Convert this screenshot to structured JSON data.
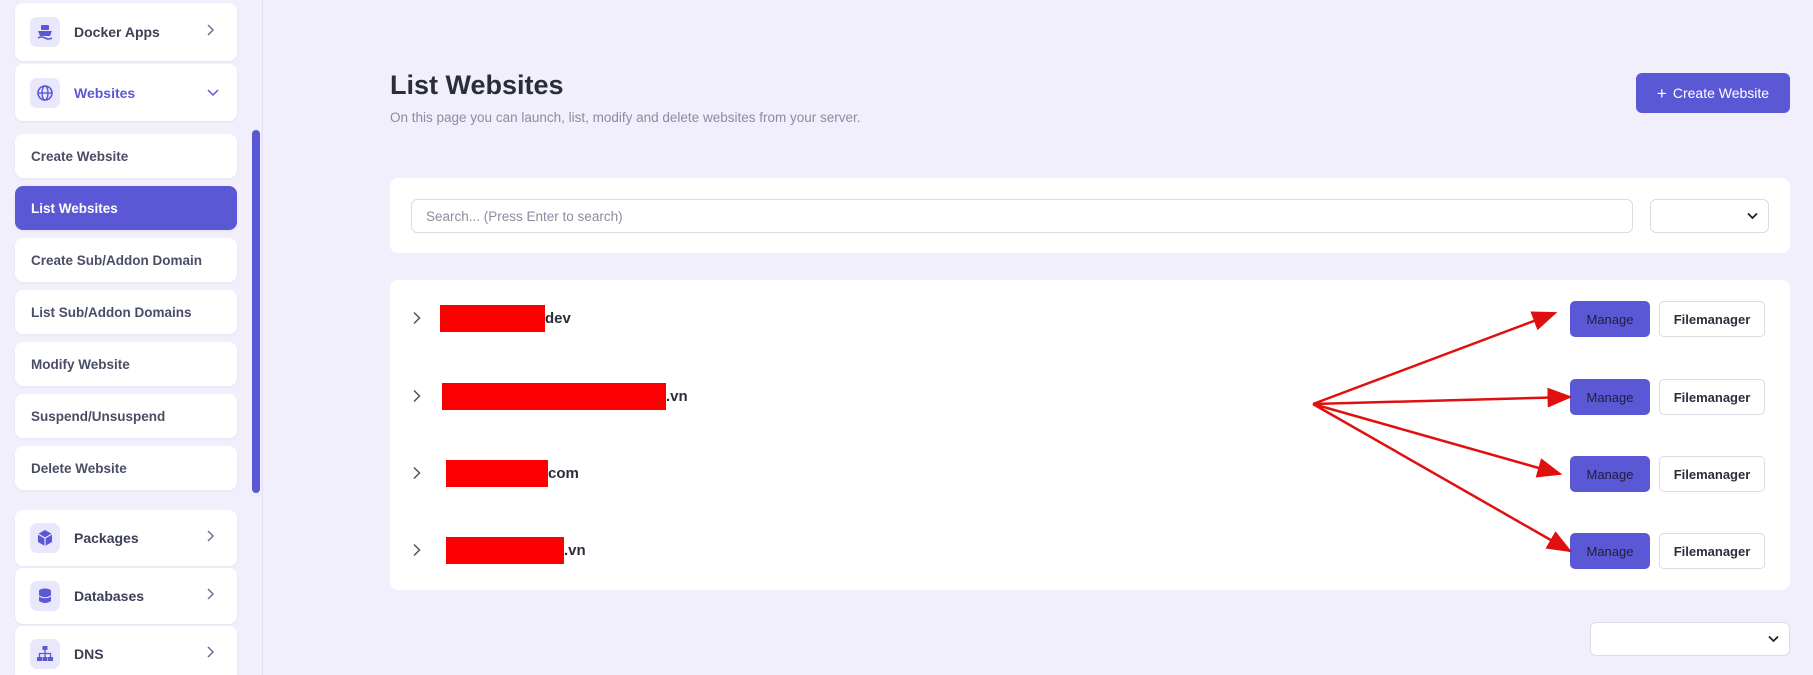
{
  "sidebar": {
    "sections_top": [
      {
        "label": "Docker Apps",
        "icon": "ship-icon"
      },
      {
        "label": "Websites",
        "icon": "globe-icon"
      }
    ],
    "submenu": [
      {
        "label": "Create Website"
      },
      {
        "label": "List Websites"
      },
      {
        "label": "Create Sub/Addon Domain"
      },
      {
        "label": "List Sub/Addon Domains"
      },
      {
        "label": "Modify Website"
      },
      {
        "label": "Suspend/Unsuspend"
      },
      {
        "label": "Delete Website"
      }
    ],
    "sections_bottom": [
      {
        "label": "Packages",
        "icon": "box-icon"
      },
      {
        "label": "Databases",
        "icon": "database-icon"
      },
      {
        "label": "DNS",
        "icon": "sitemap-icon"
      }
    ]
  },
  "header": {
    "title": "List Websites",
    "subtitle": "On this page you can launch, list, modify and delete websites from your server.",
    "create_button": "Create Website",
    "create_button_icon": "+"
  },
  "search": {
    "placeholder": "Search... (Press Enter to search)",
    "filter_value": ""
  },
  "websites": [
    {
      "domain_suffix": "dev",
      "manage_label": "Manage",
      "filemanager_label": "Filemanager"
    },
    {
      "domain_suffix": ".vn",
      "manage_label": "Manage",
      "filemanager_label": "Filemanager"
    },
    {
      "domain_suffix": "com",
      "manage_label": "Manage",
      "filemanager_label": "Filemanager"
    },
    {
      "domain_suffix": ".vn",
      "manage_label": "Manage",
      "filemanager_label": "Filemanager"
    }
  ],
  "pagination": {
    "per_page_value": ""
  },
  "colors": {
    "accent": "#5b58d6",
    "background": "#f0effb",
    "redaction": "#fa0000",
    "annotation_arrow": "#e01010"
  }
}
